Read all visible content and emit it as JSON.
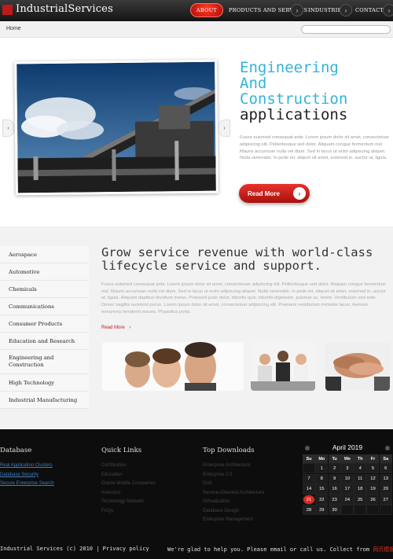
{
  "header": {
    "logo_text": "IndustrialServices",
    "nav": {
      "about": "ABOUT",
      "products": "PRODUCTS AND SERVICES",
      "industries": "INDUSTRIES",
      "contacts": "CONTACTS"
    },
    "nav_arrow_glyph": "›"
  },
  "breadcrumb": {
    "home": "Home"
  },
  "search": {
    "placeholder": ""
  },
  "hero": {
    "title_line1": "Engineering",
    "title_line2": "And",
    "title_line3": "Construction",
    "title_line4": "applications",
    "text": "Fusce euismod consequat ante. Lorem ipsum dolor sit amet, consectetuer adipiscing elit. Pellentesque sed dolor. Aliquam congue fermentum nisl. Mauris accumsan nulla vel diam. Sed in lacus ut enim adipiscing aliquet. Nulla venenatis. In pede mi, aliquet sit amet, euismod in, auctor ut, ligula.",
    "button_label": "Read More",
    "button_glyph": "›",
    "prev_glyph": "‹",
    "next_glyph": "›"
  },
  "sidebar": {
    "items": [
      "Aerospace",
      "Automotive",
      "Chemicals",
      "Communications",
      "Consumer Products",
      "Education and Research",
      "Engineering and Construction",
      "High Technology",
      "Industrial Manufacturing"
    ]
  },
  "main": {
    "title": "Grow service revenue with world-class lifecycle service and support.",
    "text": "Fusce euismod consequat ante. Lorem ipsum dolor sit amet, consectetuer adipiscing elit. Pellentesque sed dolor. Aliquam congue fermentum nisl. Mauris accumsan nulla vel diam. Sed in lacus ut enim adipiscing aliquet. Nulla venenatis. In pede mi, aliquet sit amet, euismod in, auctor ut, ligula. Aliquam dapibus tincidunt metus. Praesent justo dolor, lobortis quis, lobortis dignissim, pulvinar ac, lorem. Vestibulum sed ante. Donec sagittis euismod purus. Lorem ipsum dolor sit amet, consectetuer adipiscing elit. Praesent vestibulum molestie lacus. Aenean nonummy hendrerit mauris. Phasellus porta.",
    "read_more": "Read More",
    "read_more_glyph": "›"
  },
  "footer": {
    "database": {
      "title": "Database",
      "links": [
        "Real Application Clusters",
        "Database Security",
        "Secure Enterprise Search"
      ]
    },
    "quick_links": {
      "title": "Quick Links",
      "items": [
        "Certification",
        "Education",
        "Oracle Mobile Companies",
        "Investors",
        "Technology Network",
        "FAQs"
      ]
    },
    "top_downloads": {
      "title": "Top Downloads",
      "items": [
        "Enterprise Architecture",
        "Enterprise 2.0",
        "Grid",
        "Service-Oriented Architecture",
        "Virtualization",
        "Database Design",
        "Enterprise Management"
      ]
    },
    "calendar": {
      "month": "April 2019",
      "dow": [
        "Su",
        "Mo",
        "Tu",
        "We",
        "Th",
        "Fr",
        "Sa"
      ],
      "start_offset": 1,
      "days_in_month": 30,
      "today": 21
    },
    "copyright": "Industrial Services (c) 2010 | Privacy policy",
    "contact_note": "We're glad to help you. Please email or call us.",
    "collect_label": "Collect from",
    "collect_site": "网页模板"
  },
  "colors": {
    "accent_red": "#c0191a",
    "accent_blue": "#32b3d9",
    "footer_bg": "#0d0d0d"
  }
}
